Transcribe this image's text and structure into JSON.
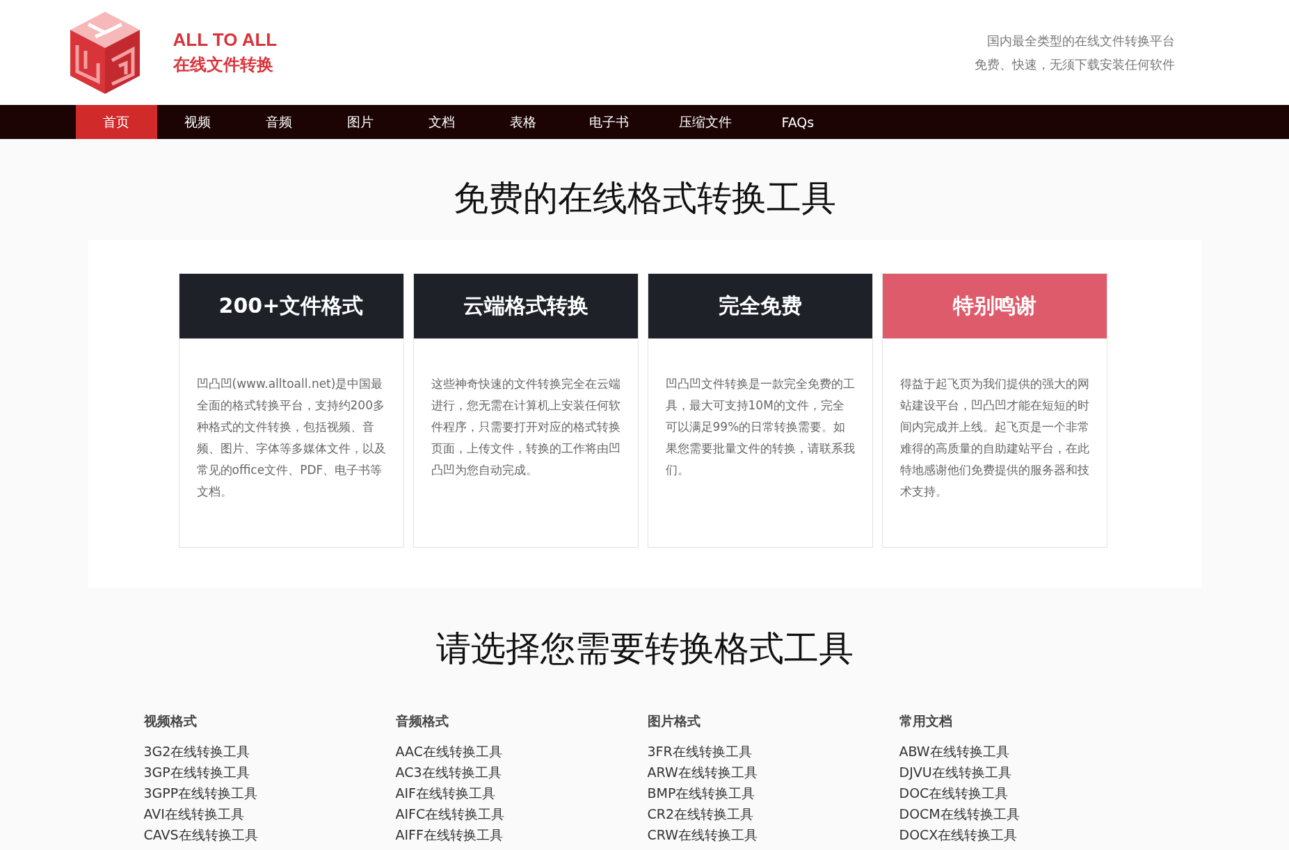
{
  "header": {
    "logo_title": "ALL TO ALL",
    "logo_subtitle": "在线文件转换",
    "tagline": [
      "国内最全类型的在线文件转换平台",
      "免费、快速，无须下载安装任何软件"
    ]
  },
  "nav": [
    {
      "label": "首页",
      "selected": true
    },
    {
      "label": "视频",
      "selected": false
    },
    {
      "label": "音频",
      "selected": false
    },
    {
      "label": "图片",
      "selected": false
    },
    {
      "label": "文档",
      "selected": false
    },
    {
      "label": "表格",
      "selected": false
    },
    {
      "label": "电子书",
      "selected": false
    },
    {
      "label": "压缩文件",
      "selected": false
    },
    {
      "label": "FAQs",
      "selected": false
    }
  ],
  "hero_title": "免费的在线格式转换工具",
  "features": [
    {
      "title": "200+文件格式",
      "color": "#1f2129",
      "text": "凹凸凹(www.alltoall.net)是中国最全面的格式转换平台，支持约200多种格式的文件转换，包括视频、音频、图片、字体等多媒体文件，以及常见的office文件、PDF、电子书等文档。"
    },
    {
      "title": "云端格式转换",
      "color": "#1f2129",
      "text": "这些神奇快速的文件转换完全在云端进行，您无需在计算机上安装任何软件程序，只需要打开对应的格式转换页面，上传文件，转换的工作将由凹凸凹为您自动完成。"
    },
    {
      "title": "完全免费",
      "color": "#1f2129",
      "text": "凹凸凹文件转换是一款完全免费的工具，最大可支持10M的文件，完全可以满足99%的日常转换需要。如果您需要批量文件的转换，请联系我们。"
    },
    {
      "title": "特别鸣谢",
      "color": "#de5b6b",
      "text": "得益于起飞页为我们提供的强大的网站建设平台，凹凸凹才能在短短的时间内完成并上线。起飞页是一个非常难得的高质量的自助建站平台，在此特地感谢他们免费提供的服务器和技术支持。"
    }
  ],
  "tools_title": "请选择您需要转换格式工具",
  "tool_groups": [
    {
      "heading": "视频格式",
      "items": [
        "3G2在线转换工具",
        "3GP在线转换工具",
        "3GPP在线转换工具",
        "AVI在线转换工具",
        "CAVS在线转换工具"
      ]
    },
    {
      "heading": "音频格式",
      "items": [
        "AAC在线转换工具",
        "AC3在线转换工具",
        "AIF在线转换工具",
        "AIFC在线转换工具",
        "AIFF在线转换工具"
      ]
    },
    {
      "heading": "图片格式",
      "items": [
        "3FR在线转换工具",
        "ARW在线转换工具",
        "BMP在线转换工具",
        "CR2在线转换工具",
        "CRW在线转换工具"
      ]
    },
    {
      "heading": "常用文档",
      "items": [
        "ABW在线转换工具",
        "DJVU在线转换工具",
        "DOC在线转换工具",
        "DOCM在线转换工具",
        "DOCX在线转换工具"
      ]
    }
  ]
}
